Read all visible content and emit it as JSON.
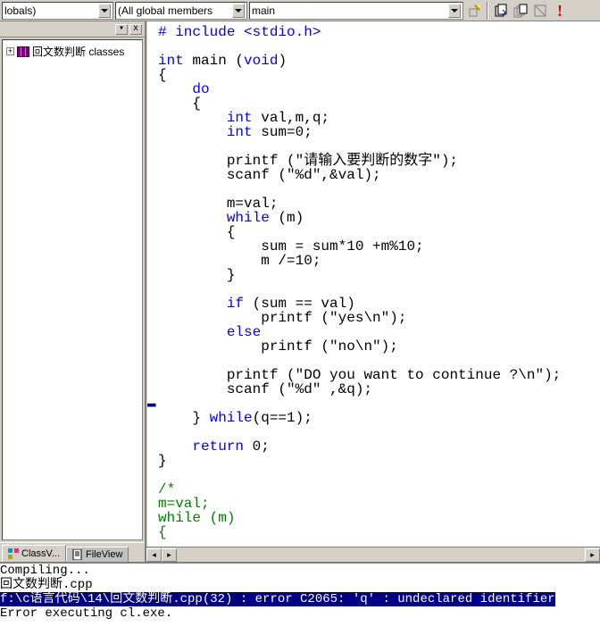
{
  "toolbar": {
    "combo1": "lobals)",
    "combo2": "(All global members",
    "combo3": "main"
  },
  "leftPanel": {
    "treeItem": "回文数判断 classes",
    "tab1": "ClassV...",
    "tab2": "FileView"
  },
  "code": {
    "l1": "# include <stdio.h>",
    "l3a": "int",
    "l3b": " main (",
    "l3c": "void",
    "l3d": ")",
    "l4": "{",
    "l5": "    do",
    "l6": "    {",
    "l7a": "        int",
    "l7b": " val,m,q;",
    "l8a": "        int",
    "l8b": " sum=0;",
    "l10": "        printf (\"请输入要判断的数字\");",
    "l11": "        scanf (\"%d\",&val);",
    "l13": "        m=val;",
    "l14a": "        while",
    "l14b": " (m)",
    "l15": "        {",
    "l16": "            sum = sum*10 +m%10;",
    "l17": "            m /=10;",
    "l18": "        }",
    "l20a": "        if",
    "l20b": " (sum == val)",
    "l21": "            printf (\"yes\\n\");",
    "l22": "        else",
    "l23": "            printf (\"no\\n\");",
    "l25": "        printf (\"DO you want to continue ?\\n\");",
    "l26": "        scanf (\"%d\" ,&q);",
    "l28a": "    } ",
    "l28b": "while",
    "l28c": "(q==1);",
    "l30a": "    return",
    "l30b": " 0;",
    "l31": "}",
    "l33": "/*",
    "l34": "m=val;",
    "l35": "while (m)",
    "l36": "{"
  },
  "output": {
    "l1": "Compiling...",
    "l2": "回文数判断.cpp",
    "l3": "f:\\c语言代码\\14\\回文数判断.cpp(32) : error C2065: 'q' : undeclared identifier",
    "l4": "Error executing cl.exe."
  }
}
